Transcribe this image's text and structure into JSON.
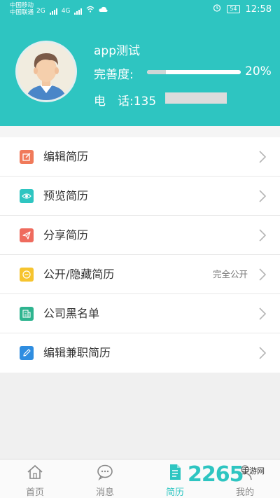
{
  "status_bar": {
    "carrier_1": "中国移动",
    "carrier_2": "中国联通",
    "net_1": "2G",
    "net_2": "4G",
    "battery": "54",
    "time": "12:58"
  },
  "profile": {
    "name": "app测试",
    "completeness_label": "完善度:",
    "completeness_fraction": 0.2,
    "completeness_value": "20%",
    "phone_label": "电　话:",
    "phone_value": "135"
  },
  "menu": {
    "items": [
      {
        "label": "编辑简历",
        "icon": "edit-icon",
        "color": "#f07a5a"
      },
      {
        "label": "预览简历",
        "icon": "eye-icon",
        "color": "#2ec5c1"
      },
      {
        "label": "分享简历",
        "icon": "send-icon",
        "color": "#ef6b5e"
      },
      {
        "label": "公开/隐藏简历",
        "icon": "public-icon",
        "color": "#f6c42f",
        "value": "完全公开"
      },
      {
        "label": "公司黑名单",
        "icon": "building-icon",
        "color": "#2eb48f"
      },
      {
        "label": "编辑兼职简历",
        "icon": "pencil-icon",
        "color": "#2f8de0"
      }
    ]
  },
  "tabbar": {
    "tabs": [
      {
        "label": "首页",
        "icon": "home-icon"
      },
      {
        "label": "消息",
        "icon": "message-icon"
      },
      {
        "label": "简历",
        "icon": "resume-icon",
        "active": true
      },
      {
        "label": "我的",
        "icon": "user-icon"
      }
    ]
  },
  "watermark": {
    "text": "2265",
    "sub": "手游网"
  },
  "colors": {
    "accent": "#2ec5c1"
  }
}
